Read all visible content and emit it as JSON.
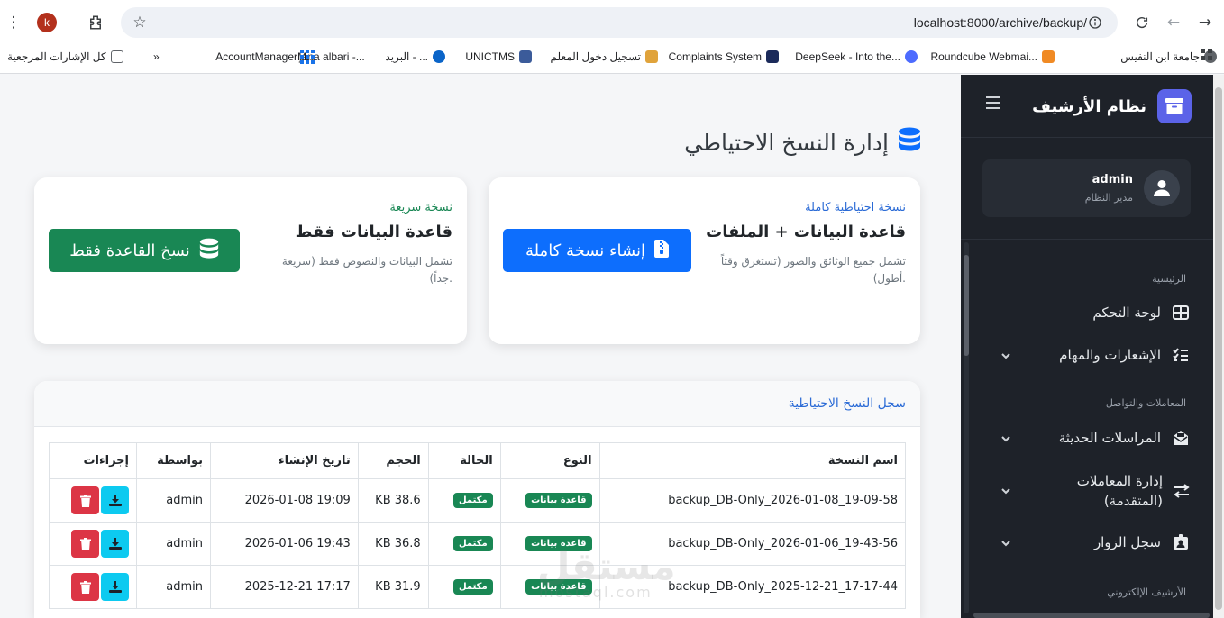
{
  "browser": {
    "url": "localhost:8000/archive/backup/",
    "profile_initial": "k",
    "bookmarks": [
      {
        "label": "جامعة ابن النفيس",
        "color": "#5f6368"
      },
      {
        "label": "Roundcube Webmai...",
        "color": "#f08a24"
      },
      {
        "label": "DeepSeek - Into the...",
        "color": "#4d6bfe"
      },
      {
        "label": "Complaints System",
        "color": "#1b2a5a"
      },
      {
        "label": "تسجيل دخول المعلم",
        "color": "#e0a33b"
      },
      {
        "label": "UNICTMS",
        "color": "#3b5b9a"
      },
      {
        "label": "البريد - ...",
        "color": "#0a64c8"
      },
      {
        "label": "jana albari -...",
        "color": "#ffffff"
      },
      {
        "label": "AccountManagerM...",
        "color": "#1a73e8"
      },
      {
        "label": "كل الإشارات المرجعية",
        "color": "#5f6368"
      }
    ]
  },
  "sidebar": {
    "brand": "نظام الأرشيف",
    "user": {
      "name": "admin",
      "role": "مدير النظام"
    },
    "sections": [
      {
        "title": "الرئيسية",
        "items": [
          {
            "label": "لوحة التحكم",
            "icon": "grid-icon",
            "chevron": false
          },
          {
            "label": "الإشعارات والمهام",
            "icon": "tasks-icon",
            "chevron": true
          }
        ]
      },
      {
        "title": "المعاملات والتواصل",
        "items": [
          {
            "label": "المراسلات الحديثة",
            "icon": "envelope-icon",
            "chevron": true
          },
          {
            "label": "إدارة المعاملات (المتقدمة)",
            "icon": "exchange-icon",
            "chevron": true
          },
          {
            "label": "سجل الزوار",
            "icon": "id-badge-icon",
            "chevron": true
          }
        ]
      },
      {
        "title": "الأرشيف الإلكتروني",
        "items": []
      }
    ]
  },
  "page": {
    "title": "إدارة النسخ الاحتياطي",
    "full_card": {
      "label": "نسخة احتياطية كاملة",
      "heading": "قاعدة البيانات + الملفات",
      "description": "تشمل جميع الوثائق والصور (تستغرق وقتاً أطول).",
      "button": "إنشاء نسخة كاملة"
    },
    "quick_card": {
      "label": "نسخة سريعة",
      "heading": "قاعدة البيانات فقط",
      "description": "تشمل البيانات والنصوص فقط (سريعة جداً).",
      "button": "نسخ القاعدة فقط"
    },
    "log": {
      "title": "سجل النسخ الاحتياطية",
      "columns": [
        "اسم النسخة",
        "النوع",
        "الحالة",
        "الحجم",
        "تاريخ الإنشاء",
        "بواسطة",
        "إجراءات"
      ],
      "rows": [
        {
          "name": "backup_DB-Only_2026-01-08_19-09-58",
          "type": "قاعدة بيانات",
          "status": "مكتمل",
          "size": "KB 38.6",
          "date": "19:09 2026-01-08",
          "by": "admin"
        },
        {
          "name": "backup_DB-Only_2026-01-06_19-43-56",
          "type": "قاعدة بيانات",
          "status": "مكتمل",
          "size": "KB 36.8",
          "date": "19:43 2026-01-06",
          "by": "admin"
        },
        {
          "name": "backup_DB-Only_2025-12-21_17-17-44",
          "type": "قاعدة بيانات",
          "status": "مكتمل",
          "size": "KB 31.9",
          "date": "17:17 2025-12-21",
          "by": "admin"
        }
      ]
    },
    "watermark": "مستقل",
    "watermark_url": "mostaql.com"
  },
  "colors": {
    "primary": "#0d6efd",
    "success": "#198754",
    "danger": "#dc3545",
    "info": "#0dcaf0",
    "sidebar": "#1e2229"
  }
}
